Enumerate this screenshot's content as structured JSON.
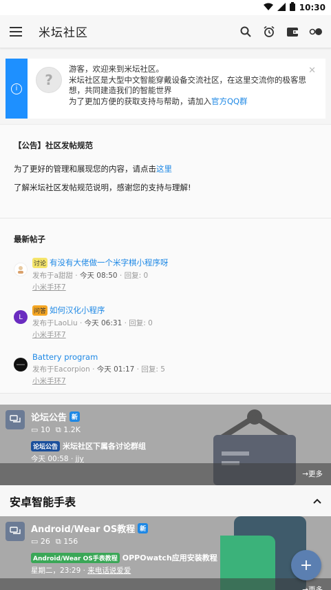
{
  "status_bar": {
    "time": "10:30"
  },
  "app_bar": {
    "title": "米坛社区"
  },
  "notice": {
    "line1": "游客，欢迎来到米坛社区。",
    "line2": "米坛社区是大型中文智能穿戴设备交流社区，在这里交流你的极客思想，共同建造我们的智能世界",
    "line3_prefix": "为了更加方便的获取支持与帮助，请加入",
    "line3_link": "官方QQ群"
  },
  "announcement": {
    "title": "【公告】社区发帖规范",
    "line1_prefix": "为了更好的管理和展现您的内容，请点击",
    "line1_link": "这里",
    "line2": "了解米坛社区发帖规范说明，感谢您的支持与理解!"
  },
  "latest": {
    "title": "最新帖子",
    "posts": [
      {
        "tag": "讨论",
        "tag_color": "#f5e56b",
        "title": "有没有大佬做一个米字棋小程序呀",
        "author": "发布于a甜甜",
        "time": "今天 08:50",
        "replies": "回复: 0",
        "forum": "小米手环7"
      },
      {
        "tag": "问答",
        "tag_color": "#f5a623",
        "title": "如何汉化小程序",
        "author": "发布于LaoLiu",
        "time": "今天 06:31",
        "replies": "回复: 0",
        "forum": "小米手环7",
        "avatar_letter": "L"
      },
      {
        "tag": "",
        "tag_color": "",
        "title": "Battery program",
        "author": "发布于Eacorpion",
        "time": "今天 01:17",
        "replies": "回复: 5",
        "forum": "小米手环7"
      }
    ]
  },
  "cards": [
    {
      "title": "论坛公告",
      "badge": "新",
      "threads": "10",
      "posts": "1.2K",
      "latest_tag": "论坛公告",
      "latest_tag_color": "#1a4f9c",
      "latest_title": "米坛社区下属各讨论群组",
      "time": "今天 00:58",
      "user": "jjy",
      "more": "更多"
    },
    {
      "title": "Android/Wear OS教程",
      "badge": "新",
      "threads": "26",
      "posts": "156",
      "latest_tag": "Android/Wear OS手表教程",
      "latest_tag_color": "#3aa757",
      "latest_title": "OPPOwatch应用安装教程",
      "time": "星期二，23:29",
      "user": "来电话说爱爱",
      "more": "更多"
    }
  ],
  "category": {
    "title": "安卓智能手表"
  },
  "colors": {
    "accent": "#1e88e5",
    "notice_strip": "#1e90ff",
    "fab": "#5b7fb1"
  }
}
